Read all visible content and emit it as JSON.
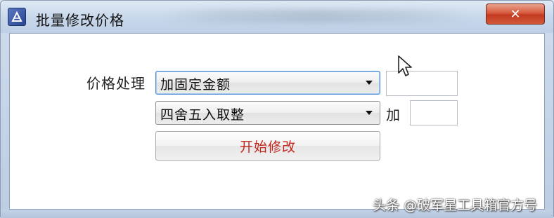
{
  "window": {
    "title": "批量修改价格",
    "close_symbol": "✕",
    "icon": "app-logo-icon"
  },
  "form": {
    "price_label": "价格处理",
    "mode_select": {
      "value": "加固定金额"
    },
    "round_select": {
      "value": "四舍五入取整"
    },
    "add_label": "加",
    "amount_input": {
      "value": ""
    },
    "add_input": {
      "value": ""
    },
    "start_button": "开始修改"
  },
  "watermark": "头条 @破军星工具箱官方号",
  "colors": {
    "accent_button_text": "#c0261a",
    "close_button": "#c94a30",
    "title_bar": "#c7d7ea"
  }
}
